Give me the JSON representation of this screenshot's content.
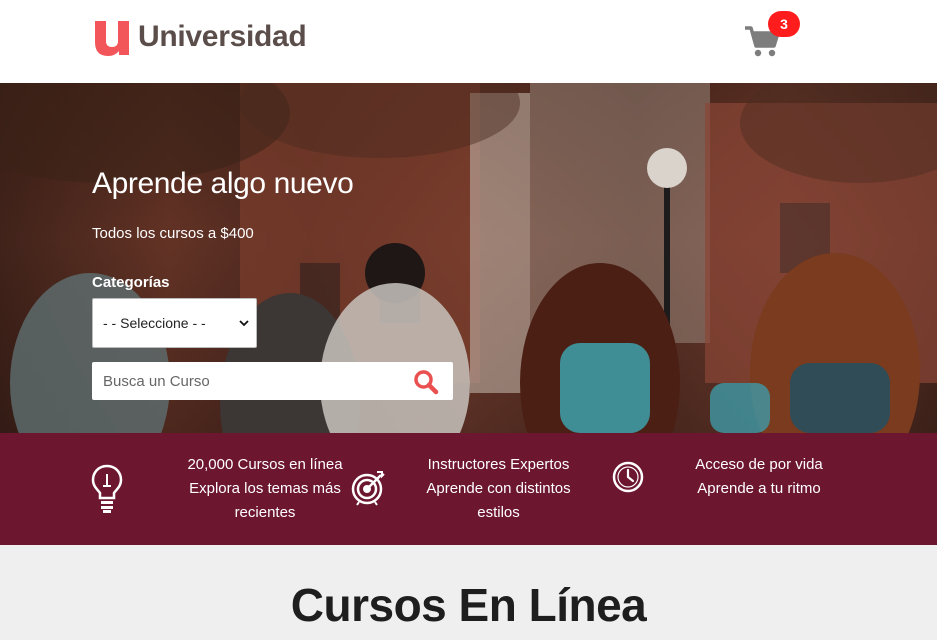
{
  "header": {
    "logo_mark": "u",
    "logo_text": "Universidad",
    "cart_icon": "cart-icon",
    "cart_count": "3"
  },
  "hero": {
    "title": "Aprende algo nuevo",
    "subtitle": "Todos los cursos a $400",
    "category_label": "Categorías",
    "category_selected": "- - Seleccione - -",
    "search_placeholder": "Busca un Curso",
    "search_icon": "search-icon"
  },
  "features": [
    {
      "icon": "lightbulb-icon",
      "line1": "20,000 Cursos en línea",
      "line2": "Explora los temas más",
      "line3": "recientes"
    },
    {
      "icon": "target-icon",
      "line1": "Instructores Expertos",
      "line2": "Aprende con distintos",
      "line3": "estilos"
    },
    {
      "icon": "clock-icon",
      "line1": "Acceso de por vida",
      "line2": "Aprende a tu ritmo",
      "line3": ""
    }
  ],
  "section": {
    "title": "Cursos En Línea"
  },
  "colors": {
    "brand_red": "#f2555a",
    "band": "#6c1630",
    "badge": "#ff1c1c",
    "cart": "#7d7d7d"
  }
}
